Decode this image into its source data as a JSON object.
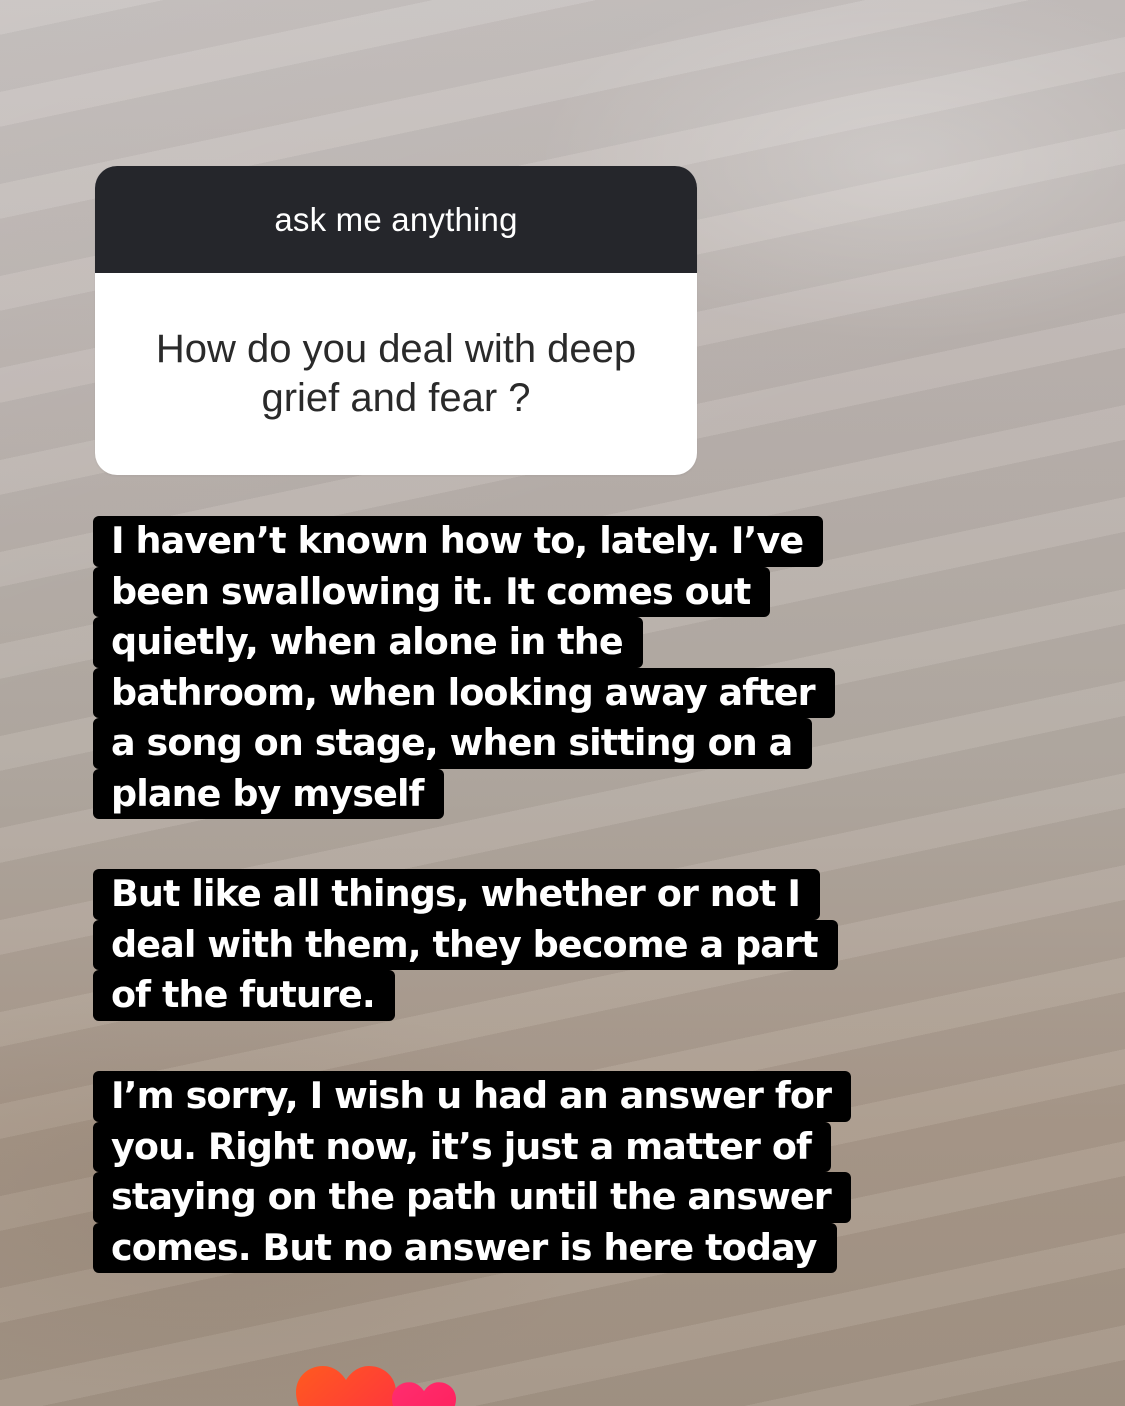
{
  "question_sticker": {
    "header": "ask me anything",
    "question": "How do you deal with deep grief and fear ?"
  },
  "answers": [
    {
      "lines": [
        "I haven’t known how to, lately. I’ve",
        "been swallowing it. It comes out",
        "quietly, when alone in the",
        "bathroom, when looking away after",
        "a song on stage, when sitting on a",
        "plane by myself"
      ]
    },
    {
      "lines": [
        "But like all things, whether or not I",
        "deal with them, they become a part",
        "of the future."
      ]
    },
    {
      "lines": [
        "I’m sorry, I wish u had an answer for",
        "you. Right now, it’s just a matter of",
        "staying on the path until the answer",
        "comes. But no answer is here today"
      ]
    }
  ],
  "reaction": {
    "icon": "heart-icon",
    "colors": [
      "#ff3b2f",
      "#ff2d6f"
    ]
  }
}
